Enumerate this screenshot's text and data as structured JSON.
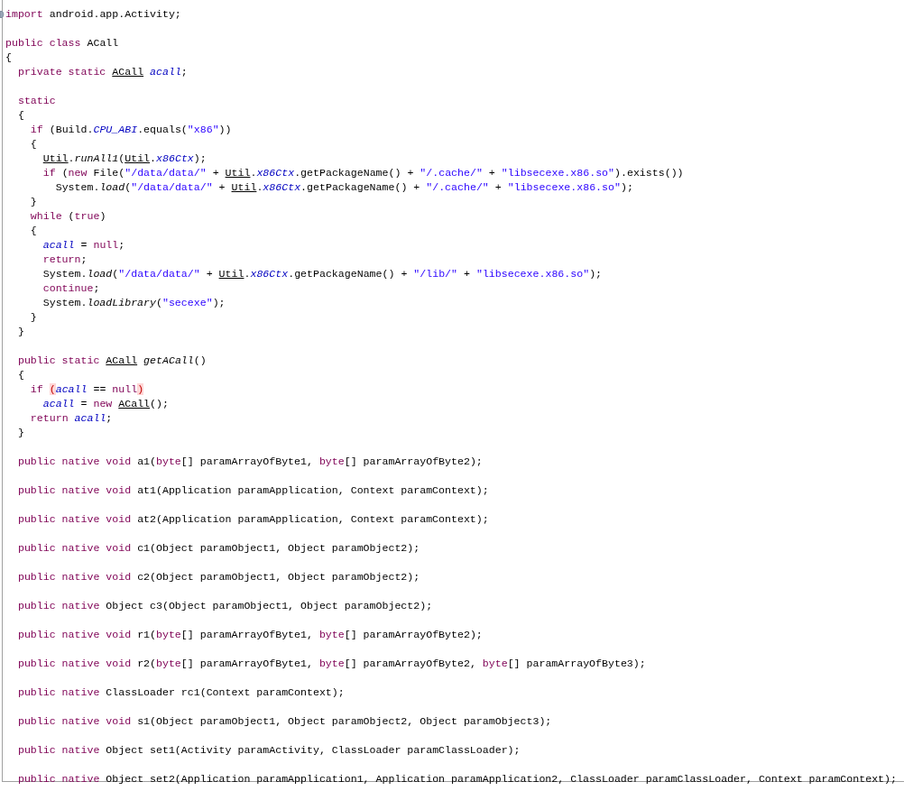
{
  "editor": {
    "blocks": [
      {
        "lines": [
          {
            "tokens": [
              {
                "kind": "keyword",
                "text": "import"
              },
              {
                "kind": "plain",
                "text": " android.app.Activity;"
              }
            ]
          }
        ]
      },
      {
        "lines": [
          {
            "tokens": [
              {
                "kind": "keyword",
                "text": "public class"
              },
              {
                "kind": "plain",
                "text": " ACall"
              }
            ]
          },
          {
            "tokens": [
              {
                "kind": "plain",
                "text": "{"
              }
            ]
          },
          {
            "tokens": [
              {
                "kind": "keyword",
                "text": "  private static "
              },
              {
                "kind": "type",
                "text": "ACall"
              },
              {
                "kind": "field",
                "text": " acall"
              },
              {
                "kind": "plain",
                "text": ";"
              }
            ]
          }
        ]
      },
      {
        "lines": [
          {
            "tokens": [
              {
                "kind": "keyword",
                "text": "  static"
              }
            ]
          },
          {
            "tokens": [
              {
                "kind": "plain",
                "text": "  {"
              }
            ]
          },
          {
            "tokens": [
              {
                "kind": "keyword",
                "text": "    if"
              },
              {
                "kind": "plain",
                "text": " (Build."
              },
              {
                "kind": "field",
                "text": "CPU_ABI"
              },
              {
                "kind": "plain",
                "text": ".equals("
              },
              {
                "kind": "string",
                "text": "\"x86\""
              },
              {
                "kind": "plain",
                "text": "))"
              }
            ]
          },
          {
            "tokens": [
              {
                "kind": "plain",
                "text": "    {"
              }
            ]
          },
          {
            "tokens": [
              {
                "kind": "type",
                "text": "      Util"
              },
              {
                "kind": "plain",
                "text": "."
              },
              {
                "kind": "method",
                "text": "runAll1"
              },
              {
                "kind": "plain",
                "text": "("
              },
              {
                "kind": "type",
                "text": "Util"
              },
              {
                "kind": "plain",
                "text": "."
              },
              {
                "kind": "field",
                "text": "x86Ctx"
              },
              {
                "kind": "plain",
                "text": ");"
              }
            ]
          },
          {
            "tokens": [
              {
                "kind": "keyword",
                "text": "      if"
              },
              {
                "kind": "plain",
                "text": " ("
              },
              {
                "kind": "keyword",
                "text": "new"
              },
              {
                "kind": "plain",
                "text": " File("
              },
              {
                "kind": "string",
                "text": "\"/data/data/\""
              },
              {
                "kind": "plain",
                "text": " + "
              },
              {
                "kind": "type",
                "text": "Util"
              },
              {
                "kind": "plain",
                "text": "."
              },
              {
                "kind": "field",
                "text": "x86Ctx"
              },
              {
                "kind": "plain",
                "text": ".getPackageName() + "
              },
              {
                "kind": "string",
                "text": "\"/.cache/\""
              },
              {
                "kind": "plain",
                "text": " + "
              },
              {
                "kind": "string",
                "text": "\"libsecexe.x86.so\""
              },
              {
                "kind": "plain",
                "text": ").exists())"
              }
            ]
          },
          {
            "tokens": [
              {
                "kind": "plain",
                "text": "        System."
              },
              {
                "kind": "method",
                "text": "load"
              },
              {
                "kind": "plain",
                "text": "("
              },
              {
                "kind": "string",
                "text": "\"/data/data/\""
              },
              {
                "kind": "plain",
                "text": " + "
              },
              {
                "kind": "type",
                "text": "Util"
              },
              {
                "kind": "plain",
                "text": "."
              },
              {
                "kind": "field",
                "text": "x86Ctx"
              },
              {
                "kind": "plain",
                "text": ".getPackageName() + "
              },
              {
                "kind": "string",
                "text": "\"/.cache/\""
              },
              {
                "kind": "plain",
                "text": " + "
              },
              {
                "kind": "string",
                "text": "\"libsecexe.x86.so\""
              },
              {
                "kind": "plain",
                "text": ");"
              }
            ]
          },
          {
            "tokens": [
              {
                "kind": "plain",
                "text": "    }"
              }
            ]
          },
          {
            "tokens": [
              {
                "kind": "keyword",
                "text": "    while"
              },
              {
                "kind": "plain",
                "text": " ("
              },
              {
                "kind": "keyword",
                "text": "true"
              },
              {
                "kind": "plain",
                "text": ")"
              }
            ]
          },
          {
            "tokens": [
              {
                "kind": "plain",
                "text": "    {"
              }
            ]
          },
          {
            "tokens": [
              {
                "kind": "field",
                "text": "      acall"
              },
              {
                "kind": "plain",
                "text": " = "
              },
              {
                "kind": "keyword",
                "text": "null"
              },
              {
                "kind": "plain",
                "text": ";"
              }
            ]
          },
          {
            "tokens": [
              {
                "kind": "keyword",
                "text": "      return"
              },
              {
                "kind": "plain",
                "text": ";"
              }
            ]
          },
          {
            "tokens": [
              {
                "kind": "plain",
                "text": "      System."
              },
              {
                "kind": "method",
                "text": "load"
              },
              {
                "kind": "plain",
                "text": "("
              },
              {
                "kind": "string",
                "text": "\"/data/data/\""
              },
              {
                "kind": "plain",
                "text": " + "
              },
              {
                "kind": "type",
                "text": "Util"
              },
              {
                "kind": "plain",
                "text": "."
              },
              {
                "kind": "field",
                "text": "x86Ctx"
              },
              {
                "kind": "plain",
                "text": ".getPackageName() + "
              },
              {
                "kind": "string",
                "text": "\"/lib/\""
              },
              {
                "kind": "plain",
                "text": " + "
              },
              {
                "kind": "string",
                "text": "\"libsecexe.x86.so\""
              },
              {
                "kind": "plain",
                "text": ");"
              }
            ]
          },
          {
            "tokens": [
              {
                "kind": "keyword",
                "text": "      continue"
              },
              {
                "kind": "plain",
                "text": ";"
              }
            ]
          },
          {
            "tokens": [
              {
                "kind": "plain",
                "text": "      System."
              },
              {
                "kind": "method",
                "text": "loadLibrary"
              },
              {
                "kind": "plain",
                "text": "("
              },
              {
                "kind": "string",
                "text": "\"secexe\""
              },
              {
                "kind": "plain",
                "text": ");"
              }
            ]
          },
          {
            "tokens": [
              {
                "kind": "plain",
                "text": "    }"
              }
            ]
          },
          {
            "tokens": [
              {
                "kind": "plain",
                "text": "  }"
              }
            ]
          }
        ]
      },
      {
        "lines": [
          {
            "tokens": [
              {
                "kind": "keyword",
                "text": "  public static "
              },
              {
                "kind": "type",
                "text": "ACall"
              },
              {
                "kind": "method",
                "text": " getACall"
              },
              {
                "kind": "plain",
                "text": "()"
              }
            ]
          },
          {
            "tokens": [
              {
                "kind": "plain",
                "text": "  {"
              }
            ]
          },
          {
            "tokens": [
              {
                "kind": "keyword",
                "text": "    if "
              },
              {
                "kind": "bracket",
                "text": "("
              },
              {
                "kind": "field",
                "text": "acall"
              },
              {
                "kind": "plain",
                "text": " == "
              },
              {
                "kind": "keyword",
                "text": "null"
              },
              {
                "kind": "bracket",
                "text": ")"
              }
            ]
          },
          {
            "tokens": [
              {
                "kind": "field",
                "text": "      acall"
              },
              {
                "kind": "plain",
                "text": " = "
              },
              {
                "kind": "keyword",
                "text": "new "
              },
              {
                "kind": "type",
                "text": "ACall"
              },
              {
                "kind": "plain",
                "text": "();"
              }
            ]
          },
          {
            "tokens": [
              {
                "kind": "keyword",
                "text": "    return"
              },
              {
                "kind": "field",
                "text": " acall"
              },
              {
                "kind": "plain",
                "text": ";"
              }
            ]
          },
          {
            "tokens": [
              {
                "kind": "plain",
                "text": "  }"
              }
            ]
          }
        ]
      },
      {
        "lines": [
          {
            "tokens": [
              {
                "kind": "keyword",
                "text": "  public native void"
              },
              {
                "kind": "plain",
                "text": " a1("
              },
              {
                "kind": "keyword",
                "text": "byte"
              },
              {
                "kind": "plain",
                "text": "[] paramArrayOfByte1, "
              },
              {
                "kind": "keyword",
                "text": "byte"
              },
              {
                "kind": "plain",
                "text": "[] paramArrayOfByte2);"
              }
            ]
          }
        ]
      },
      {
        "lines": [
          {
            "tokens": [
              {
                "kind": "keyword",
                "text": "  public native void"
              },
              {
                "kind": "plain",
                "text": " at1(Application paramApplication, Context paramContext);"
              }
            ]
          }
        ]
      },
      {
        "lines": [
          {
            "tokens": [
              {
                "kind": "keyword",
                "text": "  public native void"
              },
              {
                "kind": "plain",
                "text": " at2(Application paramApplication, Context paramContext);"
              }
            ]
          }
        ]
      },
      {
        "lines": [
          {
            "tokens": [
              {
                "kind": "keyword",
                "text": "  public native void"
              },
              {
                "kind": "plain",
                "text": " c1(Object paramObject1, Object paramObject2);"
              }
            ]
          }
        ]
      },
      {
        "lines": [
          {
            "tokens": [
              {
                "kind": "keyword",
                "text": "  public native void"
              },
              {
                "kind": "plain",
                "text": " c2(Object paramObject1, Object paramObject2);"
              }
            ]
          }
        ]
      },
      {
        "lines": [
          {
            "tokens": [
              {
                "kind": "keyword",
                "text": "  public native"
              },
              {
                "kind": "plain",
                "text": " Object c3(Object paramObject1, Object paramObject2);"
              }
            ]
          }
        ]
      },
      {
        "lines": [
          {
            "tokens": [
              {
                "kind": "keyword",
                "text": "  public native void"
              },
              {
                "kind": "plain",
                "text": " r1("
              },
              {
                "kind": "keyword",
                "text": "byte"
              },
              {
                "kind": "plain",
                "text": "[] paramArrayOfByte1, "
              },
              {
                "kind": "keyword",
                "text": "byte"
              },
              {
                "kind": "plain",
                "text": "[] paramArrayOfByte2);"
              }
            ]
          }
        ]
      },
      {
        "lines": [
          {
            "tokens": [
              {
                "kind": "keyword",
                "text": "  public native void"
              },
              {
                "kind": "plain",
                "text": " r2("
              },
              {
                "kind": "keyword",
                "text": "byte"
              },
              {
                "kind": "plain",
                "text": "[] paramArrayOfByte1, "
              },
              {
                "kind": "keyword",
                "text": "byte"
              },
              {
                "kind": "plain",
                "text": "[] paramArrayOfByte2, "
              },
              {
                "kind": "keyword",
                "text": "byte"
              },
              {
                "kind": "plain",
                "text": "[] paramArrayOfByte3);"
              }
            ]
          }
        ]
      },
      {
        "lines": [
          {
            "tokens": [
              {
                "kind": "keyword",
                "text": "  public native"
              },
              {
                "kind": "plain",
                "text": " ClassLoader rc1(Context paramContext);"
              }
            ]
          }
        ]
      },
      {
        "lines": [
          {
            "tokens": [
              {
                "kind": "keyword",
                "text": "  public native void"
              },
              {
                "kind": "plain",
                "text": " s1(Object paramObject1, Object paramObject2, Object paramObject3);"
              }
            ]
          }
        ]
      },
      {
        "lines": [
          {
            "tokens": [
              {
                "kind": "keyword",
                "text": "  public native"
              },
              {
                "kind": "plain",
                "text": " Object set1(Activity paramActivity, ClassLoader paramClassLoader);"
              }
            ]
          }
        ]
      },
      {
        "lines": [
          {
            "tokens": [
              {
                "kind": "keyword",
                "text": "  public native"
              },
              {
                "kind": "plain",
                "text": " Object set2(Application paramApplication1, Application paramApplication2, ClassLoader paramClassLoader, Context paramContext);"
              }
            ]
          }
        ]
      }
    ]
  }
}
